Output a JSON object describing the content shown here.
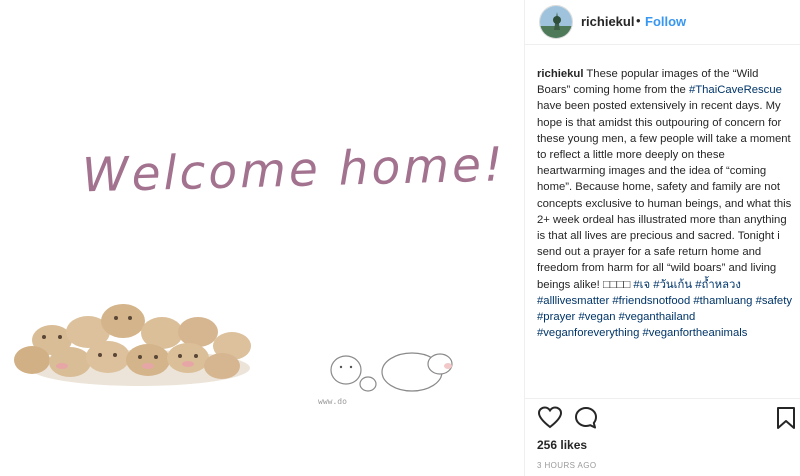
{
  "post_image": {
    "welcome_text": "Welcome home!",
    "watermark": "www.do"
  },
  "header": {
    "username": "richiekul",
    "separator": "•",
    "follow_label": "Follow"
  },
  "caption": {
    "username": "richiekul",
    "segments": [
      {
        "type": "text",
        "value": "These popular images of the “Wild Boars” coming home from the "
      },
      {
        "type": "tag",
        "value": "#ThaiCaveRescue"
      },
      {
        "type": "text",
        "value": " have been posted extensively in recent days. My hope is that amidst this outpouring of concern for these young men, a few people will take a moment to reflect a little more deeply on these heartwarming images and the idea of “coming home”. Because home, safety and family are not concepts exclusive to human beings, and what this 2+ week ordeal has illustrated more than anything is that all lives are precious and sacred. Tonight i send out a prayer for a safe return home and freedom from harm for all “wild boars” and living beings alike! □□□□ "
      },
      {
        "type": "tag",
        "value": "#เจ"
      },
      {
        "type": "text",
        "value": " "
      },
      {
        "type": "tag",
        "value": "#วันเก้น"
      },
      {
        "type": "text",
        "value": " "
      },
      {
        "type": "tag",
        "value": "#ถ้ำหลวง"
      },
      {
        "type": "text",
        "value": " "
      },
      {
        "type": "tag",
        "value": "#alllivesmatter"
      },
      {
        "type": "text",
        "value": " "
      },
      {
        "type": "tag",
        "value": "#friendsnotfood"
      },
      {
        "type": "text",
        "value": " "
      },
      {
        "type": "tag",
        "value": "#thamluang"
      },
      {
        "type": "text",
        "value": " "
      },
      {
        "type": "tag",
        "value": "#safety"
      },
      {
        "type": "text",
        "value": " "
      },
      {
        "type": "tag",
        "value": "#prayer"
      },
      {
        "type": "text",
        "value": " "
      },
      {
        "type": "tag",
        "value": "#vegan"
      },
      {
        "type": "text",
        "value": " "
      },
      {
        "type": "tag",
        "value": "#veganthailand"
      },
      {
        "type": "text",
        "value": " "
      },
      {
        "type": "tag",
        "value": "#veganforeverything"
      },
      {
        "type": "text",
        "value": " "
      },
      {
        "type": "tag",
        "value": "#veganfortheanimals"
      }
    ]
  },
  "actions": {
    "like_icon": "heart-icon",
    "comment_icon": "comment-icon",
    "save_icon": "bookmark-icon"
  },
  "likes": "256 likes",
  "time_ago": "3 HOURS AGO",
  "colors": {
    "link_blue": "#3897f0",
    "hashtag": "#003569",
    "welcome_text": "#a2728f",
    "boar_fill": "#d9bd97",
    "timestamp": "#999999"
  }
}
